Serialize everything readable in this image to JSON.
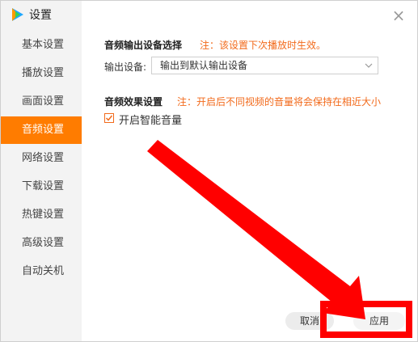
{
  "window": {
    "title": "设置",
    "close_glyph": "×"
  },
  "sidebar": {
    "items": [
      {
        "label": "基本设置"
      },
      {
        "label": "播放设置"
      },
      {
        "label": "画面设置"
      },
      {
        "label": "音频设置",
        "active": true
      },
      {
        "label": "网络设置"
      },
      {
        "label": "下载设置"
      },
      {
        "label": "热键设置"
      },
      {
        "label": "高级设置"
      },
      {
        "label": "自动关机"
      }
    ]
  },
  "audio_output": {
    "title": "音频输出设备选择",
    "note": "注：该设置下次播放时生效。",
    "field_label": "输出设备:",
    "selected_value": "输出到默认输出设备"
  },
  "audio_effect": {
    "title": "音频效果设置",
    "note": "注：开启后不同视频的音量将会保持在相近大小",
    "checkbox_label": "开启智能音量",
    "checked": true
  },
  "footer": {
    "cancel_label": "取消",
    "apply_label": "应用"
  },
  "colors": {
    "accent": "#ff7c00",
    "note": "#f26a1b",
    "annotation_red": "#ff0000"
  },
  "icons": [
    "app-logo-icon",
    "close-icon",
    "chevron-down-icon",
    "check-icon"
  ]
}
